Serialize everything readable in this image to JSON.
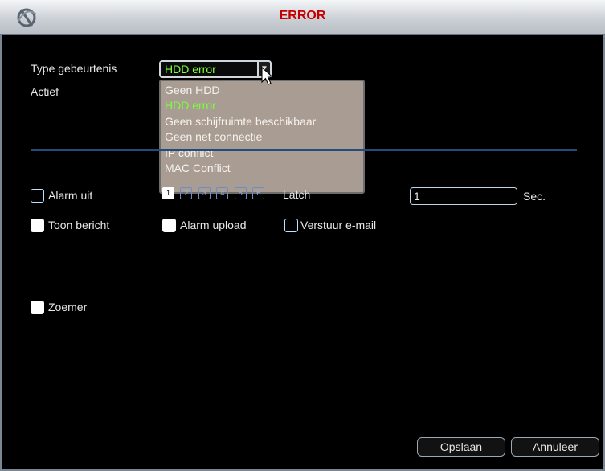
{
  "window": {
    "title": "ERROR"
  },
  "form": {
    "event_type_label": "Type gebeurtenis",
    "event_type_value": "HDD error",
    "active_label": "Actief",
    "event_type_options": [
      "Geen HDD",
      "HDD error",
      "Geen schijfruimte beschikbaar",
      "Geen net connectie",
      "IP conflict",
      "MAC Conflict"
    ],
    "alarm_out_label": "Alarm uit",
    "alarm_out_channels": [
      "1",
      "2",
      "3",
      "4",
      "5",
      "6"
    ],
    "latch_label": "Latch",
    "latch_value": "1",
    "latch_unit": "Sec.",
    "show_message_label": "Toon bericht",
    "alarm_upload_label": "Alarm upload",
    "send_email_label": "Verstuur e-mail",
    "buzzer_label": "Zoemer"
  },
  "buttons": {
    "save": "Opslaan",
    "cancel": "Annuleer"
  },
  "colors": {
    "title": "#c40000",
    "selected_text": "#7cff3a",
    "dropdown_bg": "#a99c93"
  }
}
